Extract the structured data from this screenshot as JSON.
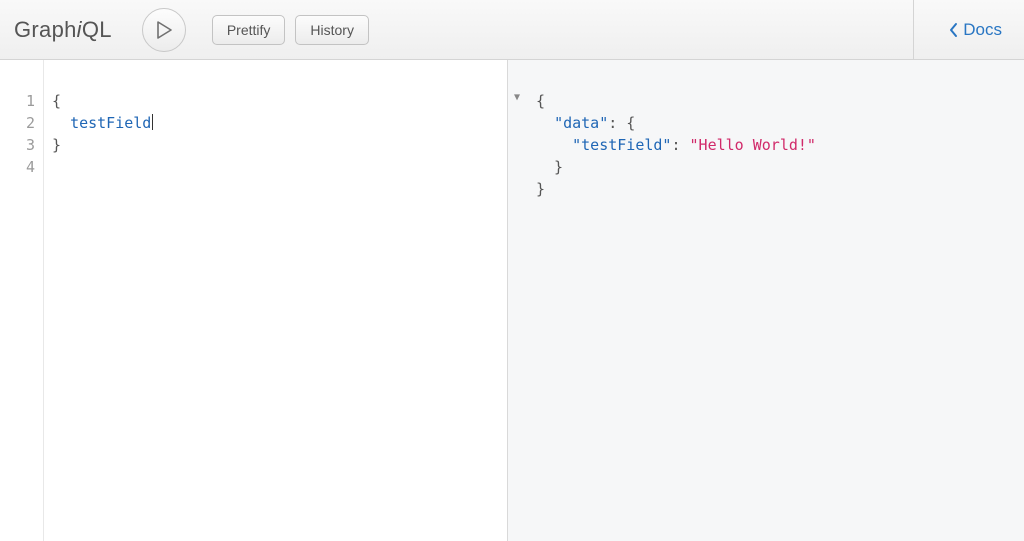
{
  "toolbar": {
    "logo_graph": "Graph",
    "logo_i": "i",
    "logo_ql": "QL",
    "prettify_label": "Prettify",
    "history_label": "History",
    "docs_label": "Docs"
  },
  "editor": {
    "line_numbers": [
      "1",
      "2",
      "3",
      "4"
    ],
    "lines": [
      {
        "indent": "",
        "text": "{",
        "cls": ""
      },
      {
        "indent": "  ",
        "text": "testField",
        "cls": "tok-field"
      },
      {
        "indent": "",
        "text": "}",
        "cls": ""
      },
      {
        "indent": "",
        "text": "",
        "cls": ""
      }
    ],
    "caret_line": 1
  },
  "result": {
    "tokens": [
      [
        {
          "t": "{",
          "c": ""
        }
      ],
      [
        {
          "t": "  ",
          "c": ""
        },
        {
          "t": "\"data\"",
          "c": "tok-key"
        },
        {
          "t": ": {",
          "c": ""
        }
      ],
      [
        {
          "t": "    ",
          "c": ""
        },
        {
          "t": "\"testField\"",
          "c": "tok-key"
        },
        {
          "t": ": ",
          "c": ""
        },
        {
          "t": "\"Hello World!\"",
          "c": "tok-str"
        }
      ],
      [
        {
          "t": "  }",
          "c": ""
        }
      ],
      [
        {
          "t": "}",
          "c": ""
        }
      ]
    ]
  }
}
